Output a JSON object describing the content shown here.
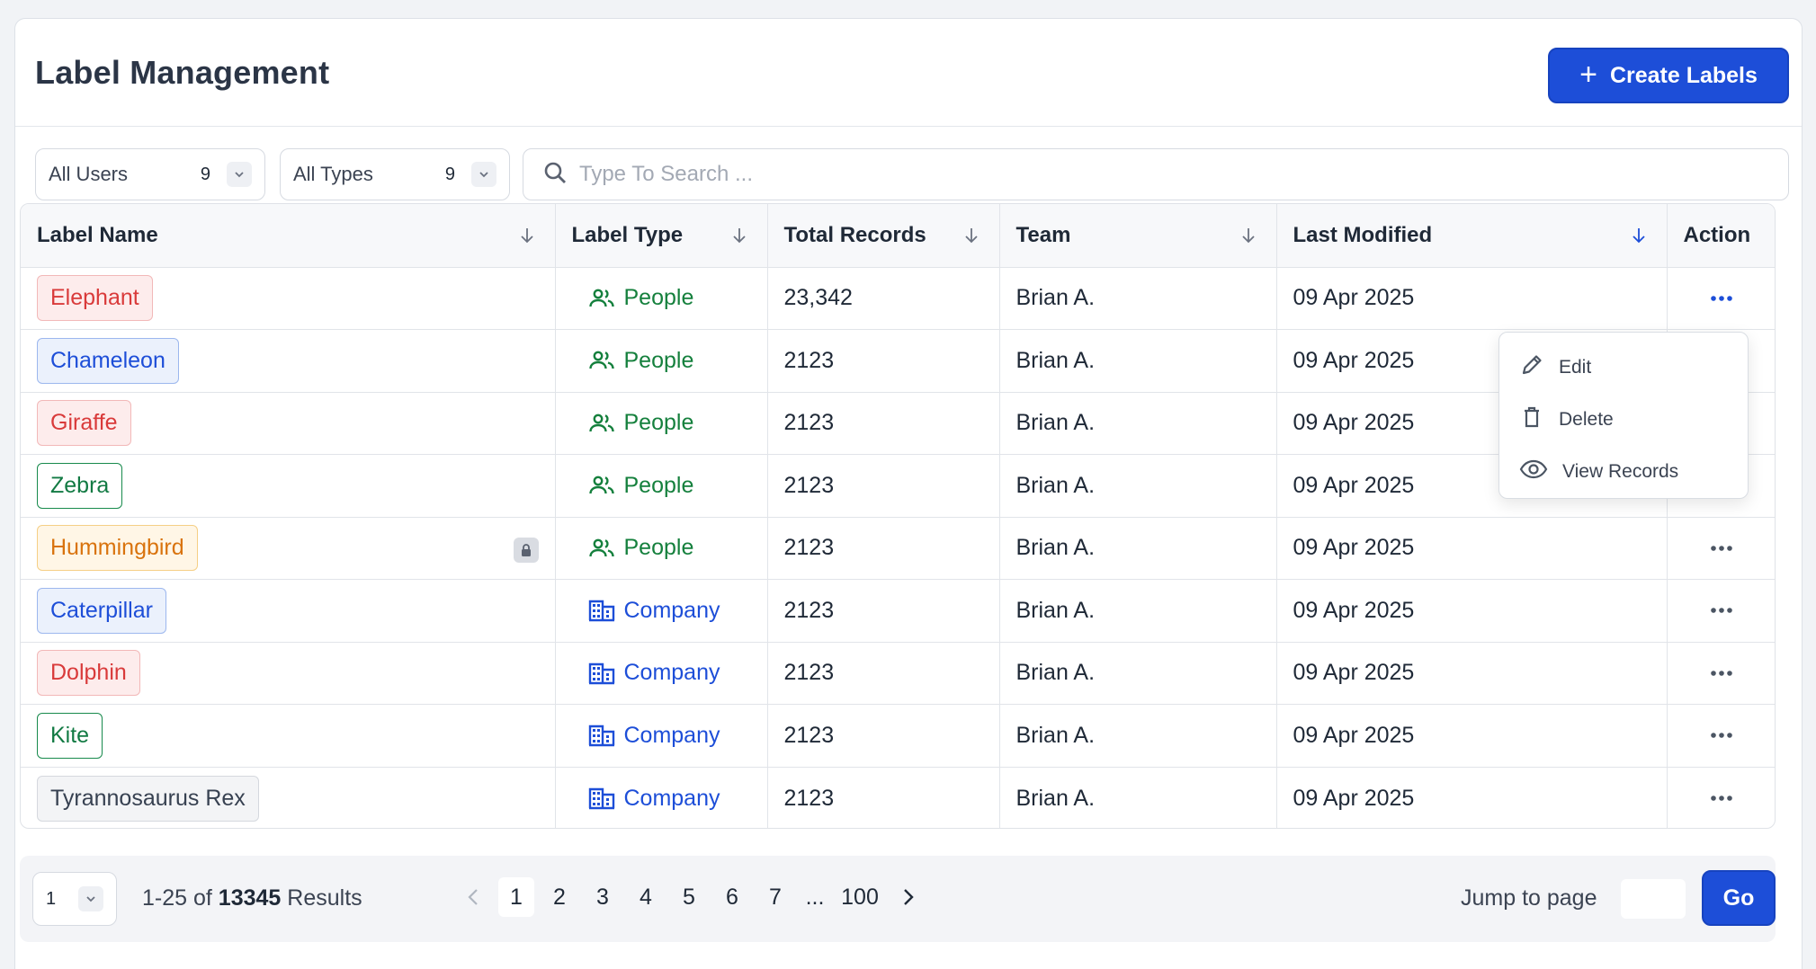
{
  "header": {
    "title": "Label Management",
    "create_label": "Create Labels",
    "create_icon": "plus-icon"
  },
  "filters": {
    "users": {
      "label": "All Users",
      "count": "9"
    },
    "types": {
      "label": "All Types",
      "count": "9"
    },
    "search_placeholder": "Type To Search ..."
  },
  "table": {
    "columns": [
      "Label Name",
      "Label Type",
      "Total Records",
      "Team",
      "Last Modified",
      "Action"
    ],
    "sorted_column": "Last Modified",
    "rows": [
      {
        "name": "Elephant",
        "tag_style": "red",
        "type": "People",
        "records": "23,342",
        "team": "Brian A.",
        "modified": "09 Apr 2025"
      },
      {
        "name": "Chameleon",
        "tag_style": "blue",
        "type": "People",
        "records": "2123",
        "team": "Brian A.",
        "modified": "09 Apr 2025"
      },
      {
        "name": "Giraffe",
        "tag_style": "red",
        "type": "People",
        "records": "2123",
        "team": "Brian A.",
        "modified": "09 Apr 2025"
      },
      {
        "name": "Zebra",
        "tag_style": "green",
        "type": "People",
        "records": "2123",
        "team": "Brian A.",
        "modified": "09 Apr 2025"
      },
      {
        "name": "Hummingbird",
        "tag_style": "orange",
        "type": "People",
        "records": "2123",
        "team": "Brian A.",
        "modified": "09 Apr 2025",
        "locked": true
      },
      {
        "name": "Caterpillar",
        "tag_style": "blue",
        "type": "Company",
        "records": "2123",
        "team": "Brian A.",
        "modified": "09 Apr 2025"
      },
      {
        "name": "Dolphin",
        "tag_style": "red",
        "type": "Company",
        "records": "2123",
        "team": "Brian A.",
        "modified": "09 Apr 2025"
      },
      {
        "name": "Kite",
        "tag_style": "green",
        "type": "Company",
        "records": "2123",
        "team": "Brian A.",
        "modified": "09 Apr 2025"
      },
      {
        "name": "Tyrannosaurus Rex",
        "tag_style": "gray",
        "type": "Company",
        "records": "2123",
        "team": "Brian A.",
        "modified": "09 Apr 2025"
      }
    ]
  },
  "action_menu": {
    "items": [
      "Edit",
      "Delete",
      "View Records"
    ]
  },
  "footer": {
    "per_page": "1",
    "results_prefix": "1-25 of",
    "results_total": "13345",
    "results_suffix": "Results",
    "pages": [
      "1",
      "2",
      "3",
      "4",
      "5",
      "6",
      "7",
      "...",
      "100"
    ],
    "current_page": "1",
    "jump_label": "Jump to page",
    "go_label": "Go"
  },
  "colors": {
    "accent": "#1d4ed8",
    "people": "#15803d",
    "company": "#1d4ed8"
  }
}
